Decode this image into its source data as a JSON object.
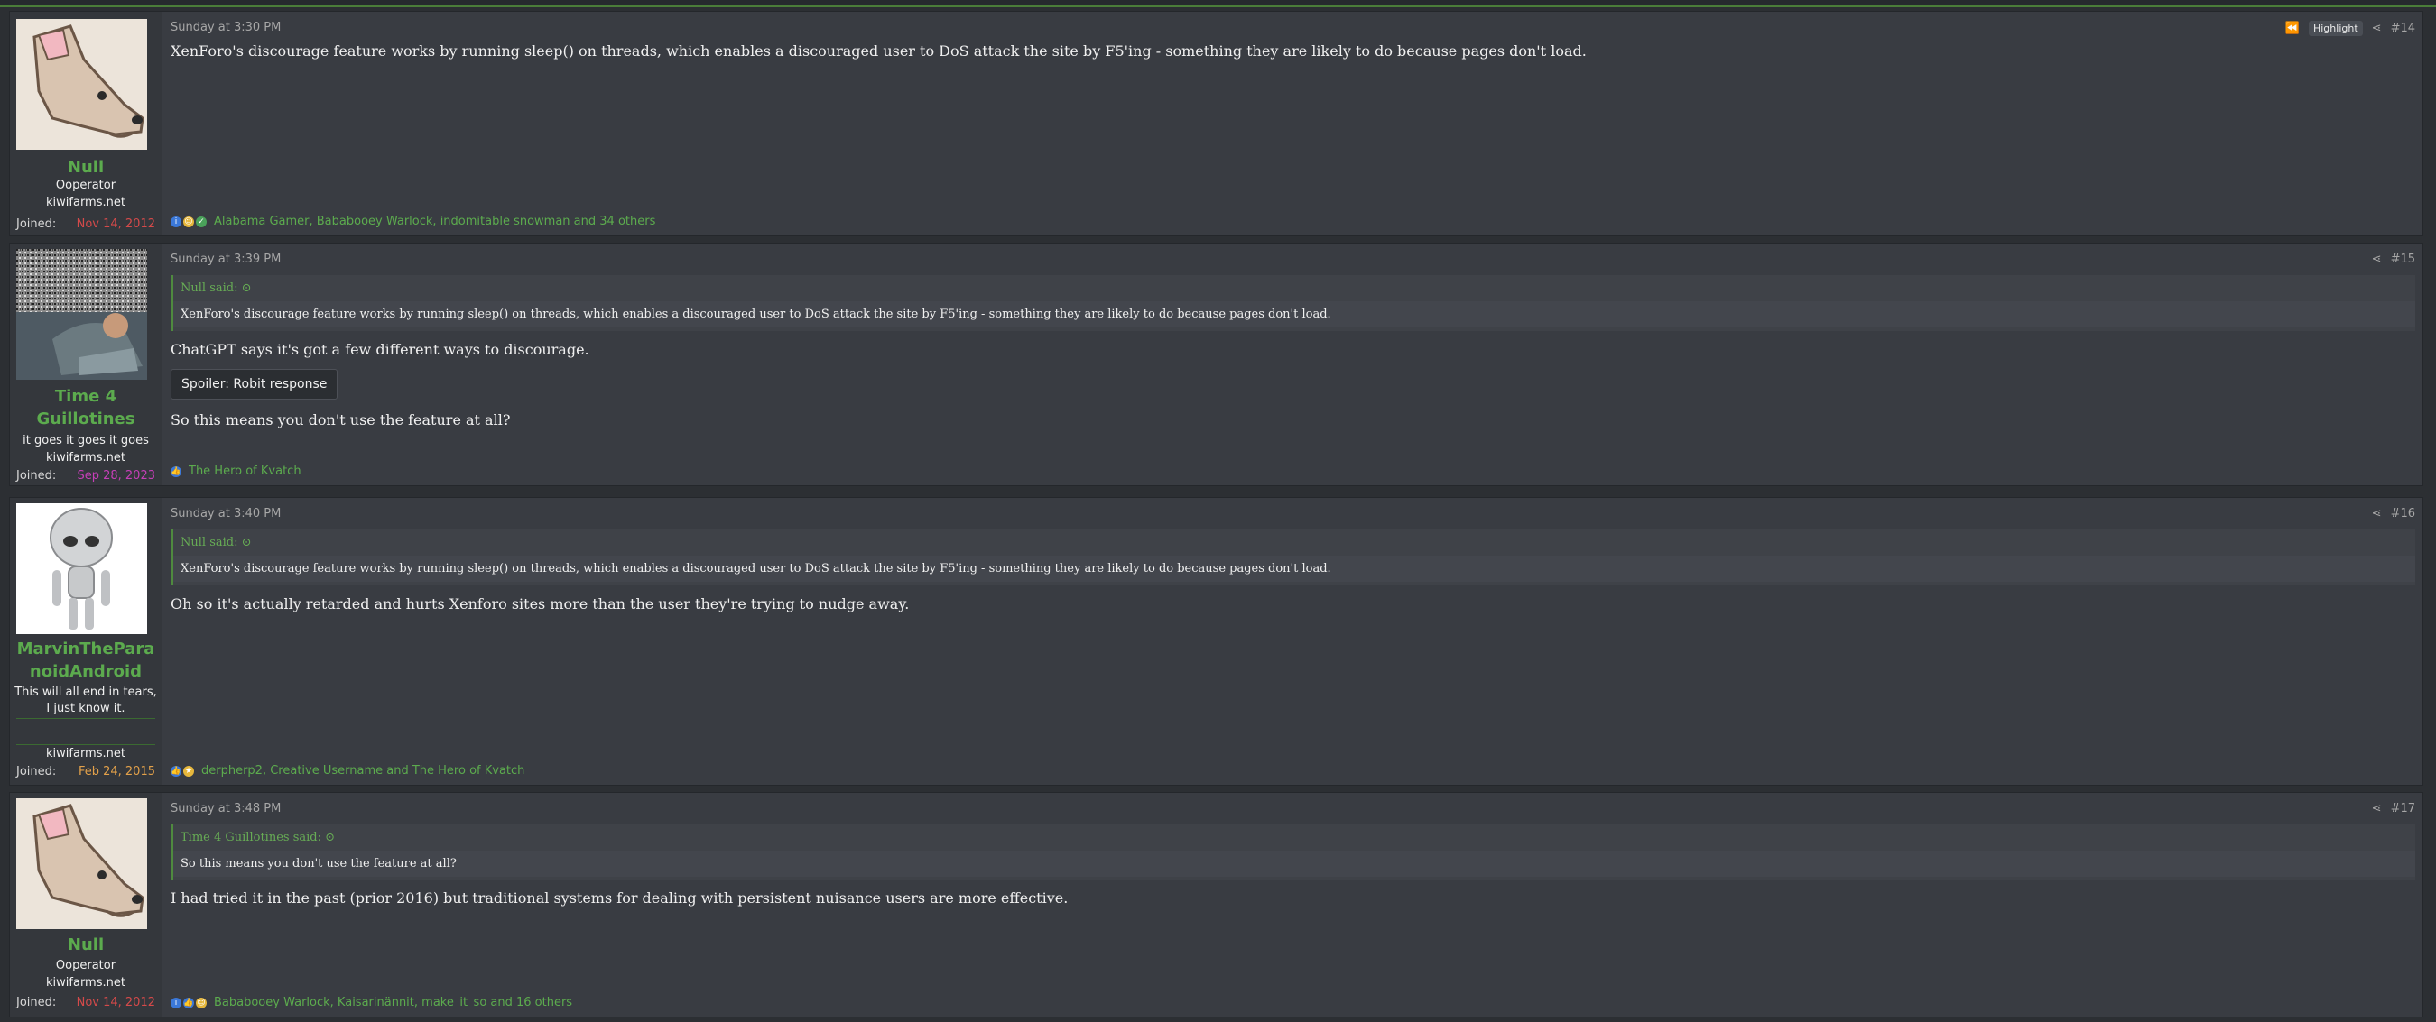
{
  "posts": [
    {
      "author": "Null",
      "title": "Ooperator",
      "site": "kiwifarms.net",
      "joined_label": "Joined:",
      "joined": "Nov 14, 2012",
      "joined_color": "#d54a4a",
      "date": "Sunday at 3:30 PM",
      "highlight": "Highlight",
      "number": "#14",
      "text": "XenForo's discourage feature works by running sleep() on threads, which enables a discouraged user to DoS attack the site by F5'ing - something they are likely to do because pages don't load.",
      "reactions": "Alabama Gamer, Bababooey Warlock, indomitable snowman and 34 others"
    },
    {
      "author": "Time 4 Guillotines",
      "author_lines": [
        "Time 4",
        "Guillotines"
      ],
      "title": "it goes it goes it goes",
      "site": "kiwifarms.net",
      "joined_label": "Joined:",
      "joined": "Sep 28, 2023",
      "joined_color": "#c63fb8",
      "date": "Sunday at 3:39 PM",
      "number": "#15",
      "quote_author": "Null said:",
      "quote_text": "XenForo's discourage feature works by running sleep() on threads, which enables a discouraged user to DoS attack the site by F5'ing - something they are likely to do because pages don't load.",
      "text": "ChatGPT says it's got a few different ways to discourage.",
      "spoiler": "Spoiler: Robit response",
      "text2": "So this means you don't use the feature at all?",
      "reactions": "The Hero of Kvatch"
    },
    {
      "author": "MarvinTheParanoidAndroid",
      "author_lines": [
        "MarvinThePara",
        "noidAndroid"
      ],
      "title_lines": [
        "This will all end in tears,",
        "I just know it."
      ],
      "site": "kiwifarms.net",
      "joined_label": "Joined:",
      "joined": "Feb 24, 2015",
      "joined_color": "#e3a14a",
      "date": "Sunday at 3:40 PM",
      "number": "#16",
      "quote_author": "Null said:",
      "quote_text": "XenForo's discourage feature works by running sleep() on threads, which enables a discouraged user to DoS attack the site by F5'ing - something they are likely to do because pages don't load.",
      "text": "Oh so it's actually retarded and hurts Xenforo sites more than the user they're trying to nudge away.",
      "reactions": "derpherp2, Creative Username and The Hero of Kvatch"
    },
    {
      "author": "Null",
      "title": "Ooperator",
      "site": "kiwifarms.net",
      "joined_label": "Joined:",
      "joined": "Nov 14, 2012",
      "joined_color": "#d54a4a",
      "date": "Sunday at 3:48 PM",
      "number": "#17",
      "quote_author": "Time 4 Guillotines said:",
      "quote_text": "So this means you don't use the feature at all?",
      "text": "I had tried it in the past (prior 2016) but traditional systems for dealing with persistent nuisance users are more effective.",
      "reactions": "Bababooey Warlock, Kaisarinännit, make_it_so and 16 others"
    }
  ]
}
